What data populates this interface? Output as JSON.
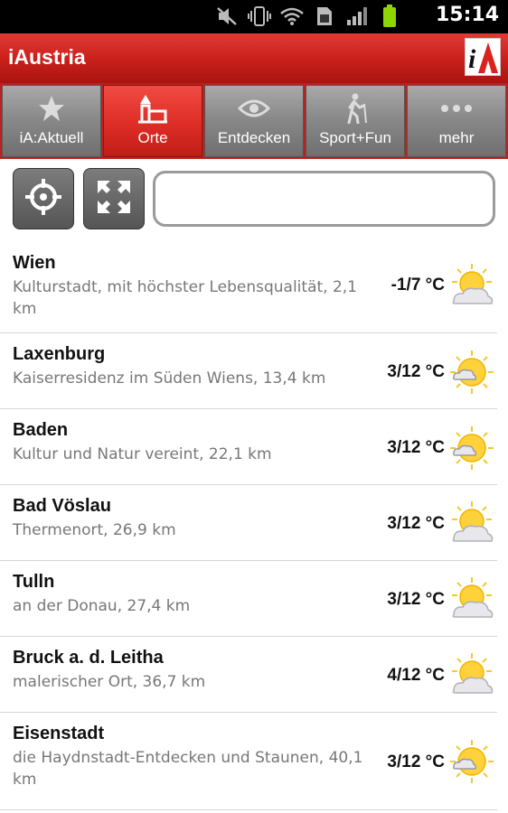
{
  "statusbar": {
    "time": "15:14",
    "icons": [
      "mute-icon",
      "vibrate-icon",
      "wifi-icon",
      "sim-icon",
      "signal-icon",
      "battery-icon"
    ]
  },
  "appbar": {
    "title": "iAustria",
    "logo": "iA"
  },
  "tabs": [
    {
      "label": "iA:Aktuell",
      "icon": "star-icon",
      "active": false
    },
    {
      "label": "Orte",
      "icon": "places-icon",
      "active": true
    },
    {
      "label": "Entdecken",
      "icon": "eye-icon",
      "active": false
    },
    {
      "label": "Sport+Fun",
      "icon": "hiker-icon",
      "active": false
    },
    {
      "label": "mehr",
      "icon": "more-icon",
      "active": false
    }
  ],
  "search": {
    "value": "",
    "placeholder": ""
  },
  "places": [
    {
      "name": "Wien",
      "desc": "Kulturstadt, mit höchster Lebensqualität, 2,1 km",
      "temp": "-1/7 °C",
      "weather": "sun-cloud-icon"
    },
    {
      "name": "Laxenburg",
      "desc": "Kaiserresidenz im Süden Wiens, 13,4 km",
      "temp": "3/12 °C",
      "weather": "sun-small-cloud-icon"
    },
    {
      "name": "Baden",
      "desc": "Kultur und Natur vereint, 22,1 km",
      "temp": "3/12 °C",
      "weather": "sun-small-cloud-icon"
    },
    {
      "name": "Bad Vöslau",
      "desc": "Thermenort, 26,9 km",
      "temp": "3/12 °C",
      "weather": "sun-cloud-icon"
    },
    {
      "name": "Tulln",
      "desc": "an der Donau, 27,4 km",
      "temp": "3/12 °C",
      "weather": "sun-cloud-icon"
    },
    {
      "name": "Bruck a. d. Leitha",
      "desc": "malerischer Ort, 36,7 km",
      "temp": "4/12 °C",
      "weather": "sun-cloud-icon"
    },
    {
      "name": "Eisenstadt",
      "desc": "die Haydnstadt-Entdecken und Staunen, 40,1 km",
      "temp": "3/12 °C",
      "weather": "sun-small-cloud-icon"
    }
  ]
}
